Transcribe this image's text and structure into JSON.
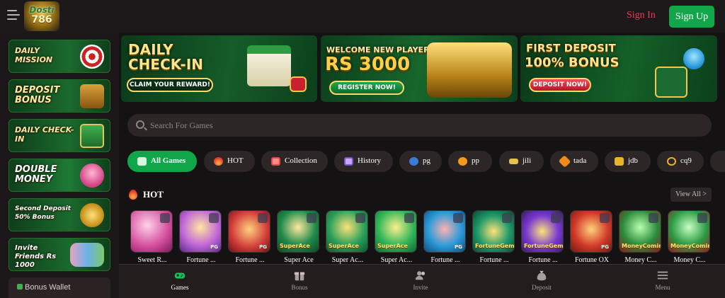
{
  "header": {
    "logo_text_top": "Dosti",
    "logo_text_bottom": "786",
    "signin_label": "Sign In",
    "signup_label": "Sign Up"
  },
  "sidebar": {
    "items": [
      {
        "label": "Daily Mission"
      },
      {
        "label": "Deposit Bonus"
      },
      {
        "label": "Daily Check-in"
      },
      {
        "label": "Double Money"
      },
      {
        "label": "Second Deposit 50% Bonus"
      },
      {
        "label": "Invite Friends Rs 1000"
      }
    ],
    "bonus_wallet_label": "Bonus Wallet"
  },
  "banners": [
    {
      "title": "DAILY CHECK-IN",
      "button": "CLAIM YOUR REWARD!"
    },
    {
      "subtitle": "WELCOME NEW PLAYERS",
      "title": "Rs 3000",
      "button": "REGISTER NOW!"
    },
    {
      "subtitle": "FIRST DEPOSIT",
      "title": "100% BONUS",
      "button": "DEPOSIT NOW!"
    }
  ],
  "search": {
    "placeholder": "Search For Games"
  },
  "tabs": [
    {
      "label": "All Games",
      "icon": "games-icon",
      "active": true
    },
    {
      "label": "HOT",
      "icon": "fire-icon"
    },
    {
      "label": "Collection",
      "icon": "collection-icon"
    },
    {
      "label": "History",
      "icon": "history-icon"
    },
    {
      "label": "pg",
      "icon": "pg-logo-icon"
    },
    {
      "label": "pp",
      "icon": "pp-logo-icon"
    },
    {
      "label": "jili",
      "icon": "jili-logo-icon"
    },
    {
      "label": "tada",
      "icon": "tada-logo-icon"
    },
    {
      "label": "jdb",
      "icon": "jdb-logo-icon"
    },
    {
      "label": "cq9",
      "icon": "cq9-logo-icon"
    }
  ],
  "hot_section": {
    "title": "HOT",
    "view_all": "View All >",
    "games": [
      {
        "name": "Sweet R..."
      },
      {
        "name": "Fortune ..."
      },
      {
        "name": "Fortune ..."
      },
      {
        "name": "Super Ace"
      },
      {
        "name": "Super Ac..."
      },
      {
        "name": "Super Ac..."
      },
      {
        "name": "Fortune ..."
      },
      {
        "name": "Fortune ..."
      },
      {
        "name": "Fortune ..."
      },
      {
        "name": "Fortune OX"
      },
      {
        "name": "Money C..."
      },
      {
        "name": "Money C..."
      }
    ]
  },
  "bottom_nav": [
    {
      "label": "Games",
      "icon": "gamepad-icon",
      "active": true
    },
    {
      "label": "Bonus",
      "icon": "gift-icon"
    },
    {
      "label": "Invite",
      "icon": "users-icon"
    },
    {
      "label": "Deposit",
      "icon": "money-bag-icon"
    },
    {
      "label": "Menu",
      "icon": "hamburger-icon"
    }
  ],
  "colors": {
    "accent_green": "#12a64a",
    "signin_red": "#e8405a",
    "background": "#151213"
  }
}
